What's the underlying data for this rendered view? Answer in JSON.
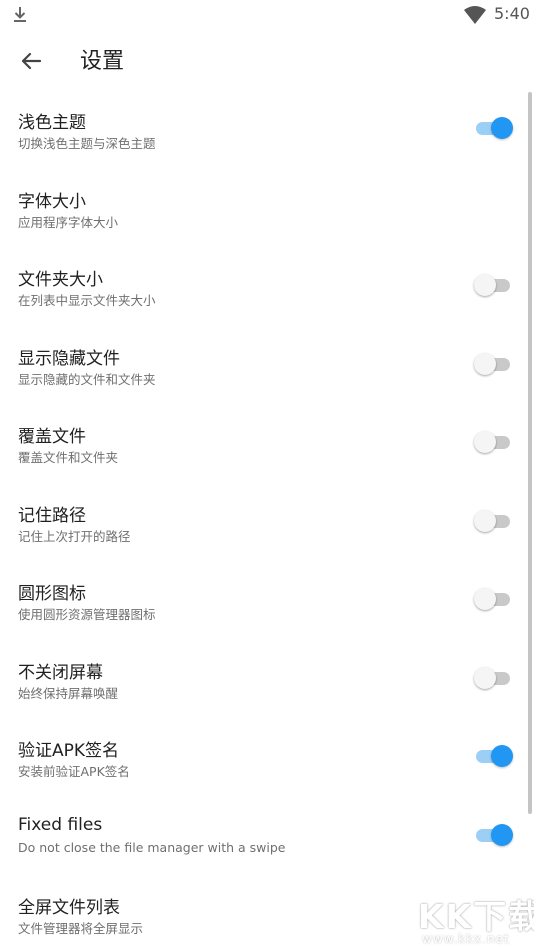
{
  "status_bar": {
    "time": "5:40",
    "icons": [
      "download-icon",
      "wifi-icon"
    ]
  },
  "app_bar": {
    "back_icon": "arrow-back-icon",
    "title": "设置"
  },
  "settings": [
    {
      "title": "浅色主题",
      "subtitle": "切换浅色主题与深色主题",
      "toggle": true
    },
    {
      "title": "字体大小",
      "subtitle": "应用程序字体大小",
      "toggle": null
    },
    {
      "title": "文件夹大小",
      "subtitle": "在列表中显示文件夹大小",
      "toggle": false
    },
    {
      "title": "显示隐藏文件",
      "subtitle": "显示隐藏的文件和文件夹",
      "toggle": false
    },
    {
      "title": "覆盖文件",
      "subtitle": "覆盖文件和文件夹",
      "toggle": false
    },
    {
      "title": "记住路径",
      "subtitle": "记住上次打开的路径",
      "toggle": false
    },
    {
      "title": "圆形图标",
      "subtitle": "使用圆形资源管理器图标",
      "toggle": false
    },
    {
      "title": "不关闭屏幕",
      "subtitle": "始终保持屏幕唤醒",
      "toggle": false
    },
    {
      "title": "验证APK签名",
      "subtitle": "安装前验证APK签名",
      "toggle": true
    },
    {
      "title": "Fixed files",
      "subtitle": "Do not close the file manager with a swipe",
      "toggle": true
    },
    {
      "title": "全屏文件列表",
      "subtitle": "文件管理器将全屏显示",
      "toggle": null
    }
  ],
  "colors": {
    "accent": "#2196f3",
    "accent_track": "#9ccff6",
    "off_track": "#c9c9c9",
    "off_thumb": "#f5f5f5"
  },
  "watermark": {
    "logo": "KK下载",
    "url": "www.kkx.net"
  }
}
